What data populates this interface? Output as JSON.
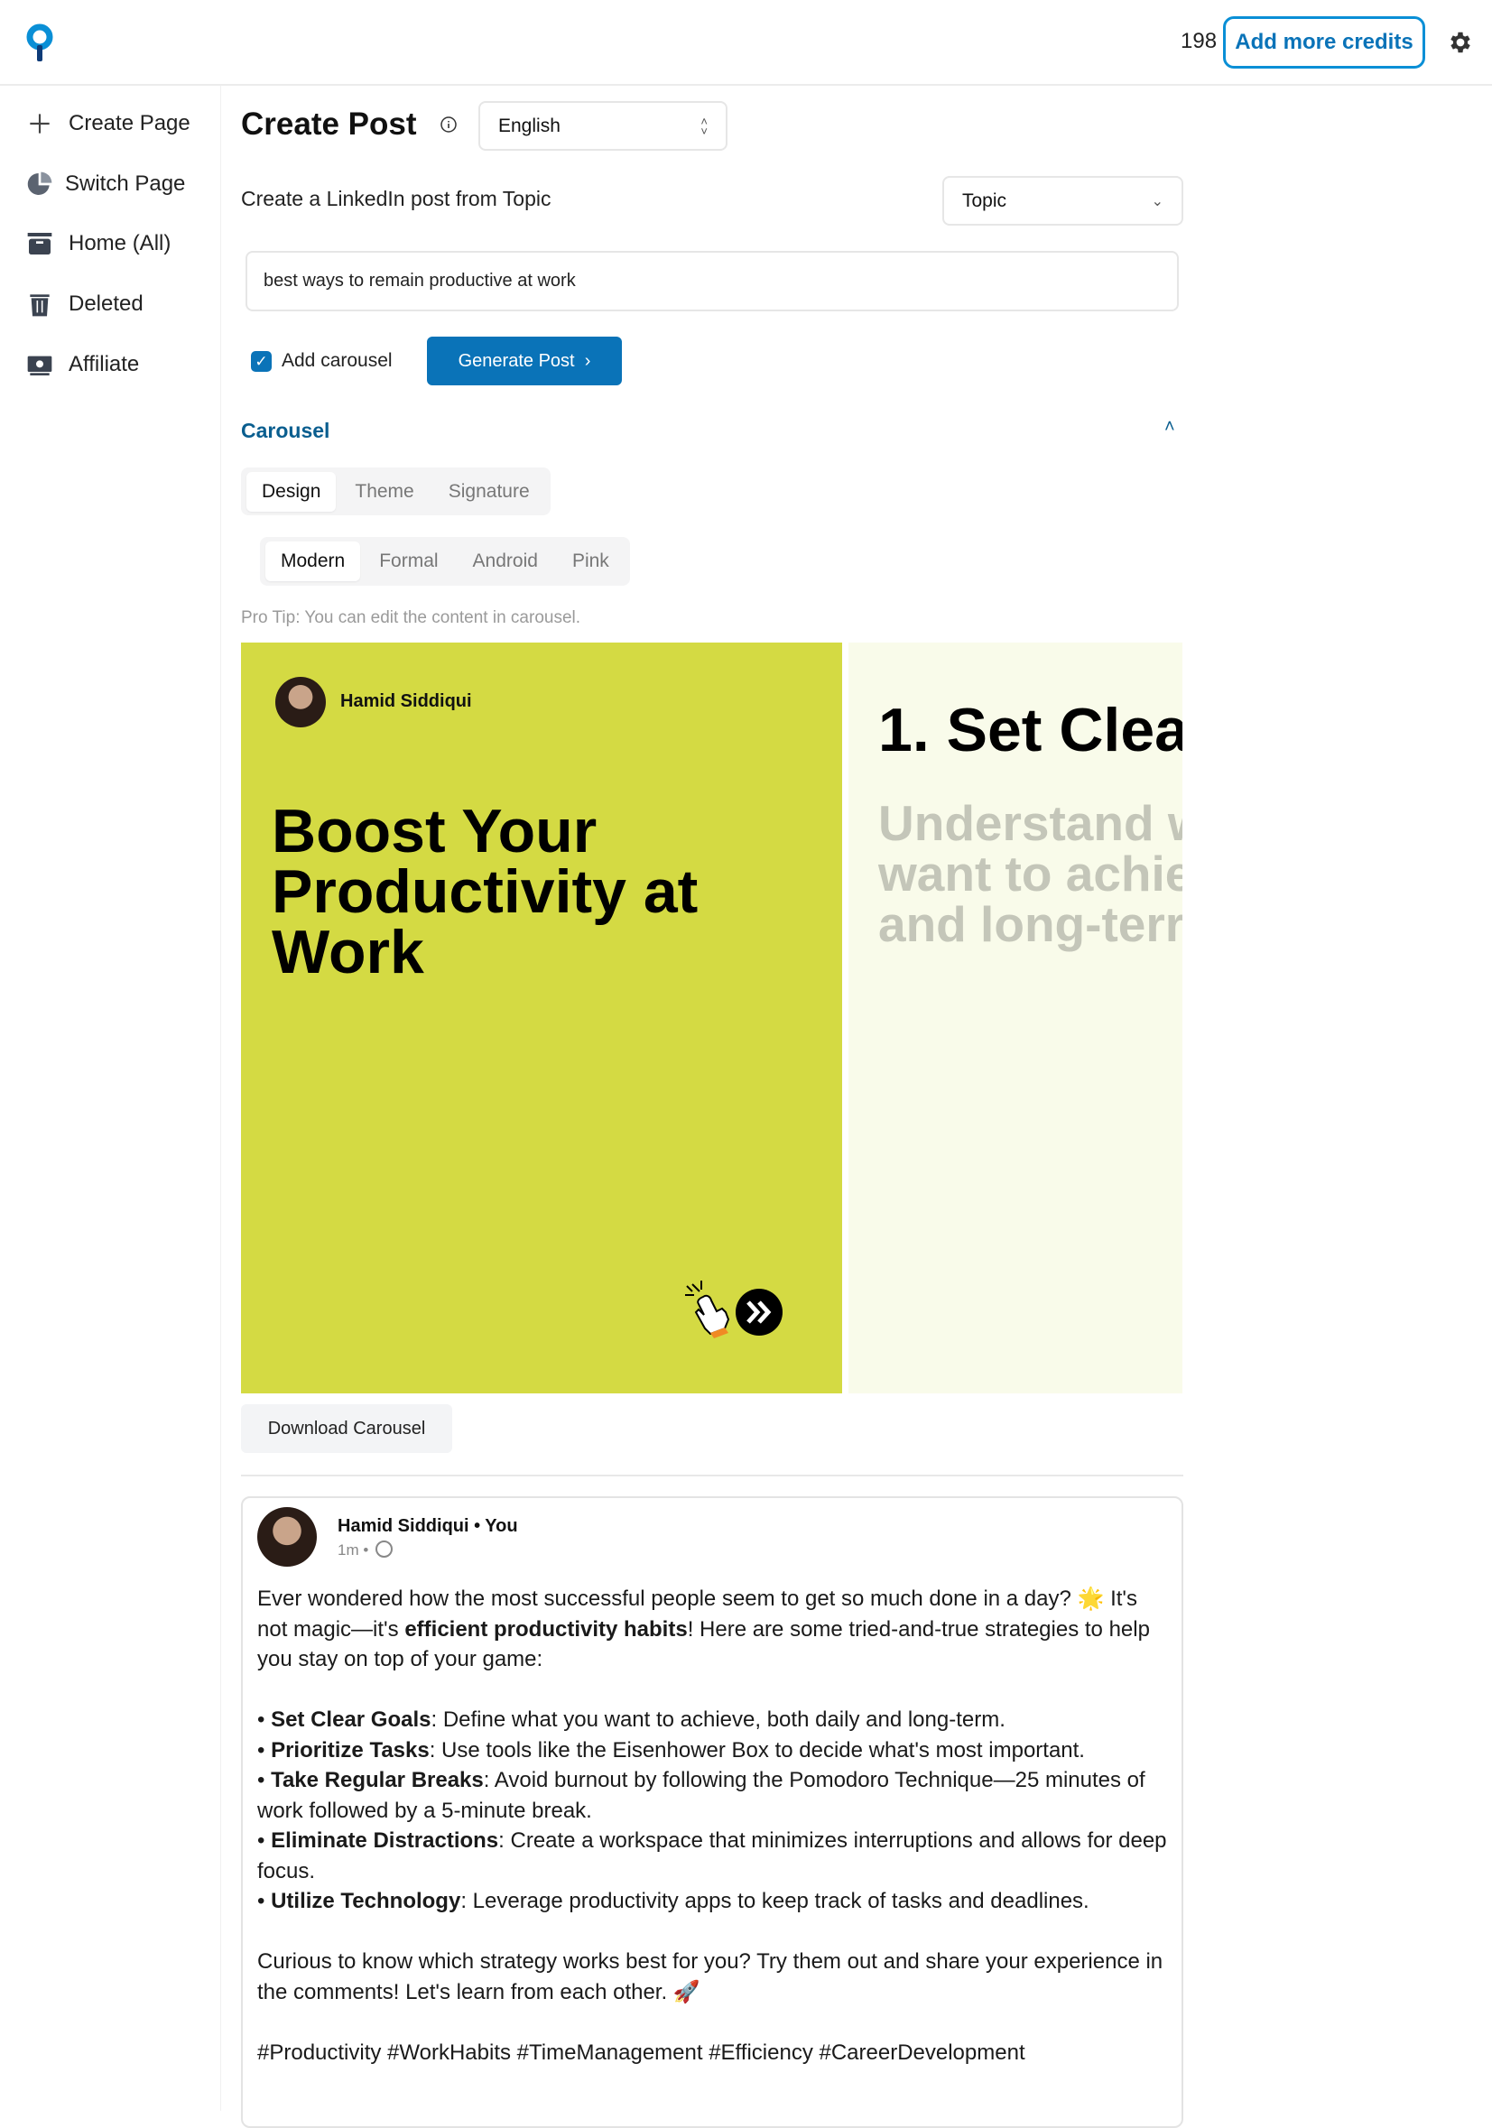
{
  "header": {
    "credits": "198",
    "add_credits_label": "Add more credits",
    "accent": "#0a73b8"
  },
  "sidebar": {
    "items": [
      {
        "label": "Create Page",
        "icon": "plus-icon"
      },
      {
        "label": "Switch Page",
        "icon": "pie-chart-icon"
      },
      {
        "label": "Home (All)",
        "icon": "archive-icon"
      },
      {
        "label": "Deleted",
        "icon": "trash-icon"
      },
      {
        "label": "Affiliate",
        "icon": "money-icon"
      }
    ]
  },
  "main": {
    "title": "Create Post",
    "language": "English",
    "source_label": "Create a LinkedIn post from Topic",
    "source_type": "Topic",
    "topic_value": "best ways to remain productive at work",
    "add_carousel_label": "Add carousel",
    "add_carousel_checked": true,
    "generate_label": "Generate Post",
    "carousel": {
      "heading": "Carousel",
      "tabs": [
        "Design",
        "Theme",
        "Signature"
      ],
      "active_tab": "Design",
      "styles": [
        "Modern",
        "Formal",
        "Android",
        "Pink"
      ],
      "active_style": "Modern",
      "pro_tip": "Pro Tip: You can edit the content in carousel.",
      "slide1": {
        "author": "Hamid Siddiqui",
        "title": "Boost Your Productivity at Work",
        "bg": "#d4da43"
      },
      "slide2": {
        "title": "1. Set Clea",
        "text": "Understand w want to achie and long-terr",
        "bg": "#f9fbea"
      },
      "download_label": "Download Carousel"
    },
    "post": {
      "author": "Hamid Siddiqui • You",
      "time": "1m •",
      "intro_a": "Ever wondered how the most successful people seem to get so much done in a day? 🌟  It's not magic—it's ",
      "intro_bold": "efficient productivity habits",
      "intro_b": "! Here are some tried-and-true strategies to help you stay on top of your game:",
      "bullets": [
        {
          "bold": "Set Clear Goals",
          "text": ": Define what you want to achieve, both daily and long-term."
        },
        {
          "bold": "Prioritize Tasks",
          "text": ": Use tools like the Eisenhower Box to decide what's most important."
        },
        {
          "bold": "Take Regular Breaks",
          "text": ": Avoid burnout by following the Pomodoro Technique—25 minutes of work followed by a 5-minute break."
        },
        {
          "bold": "Eliminate Distractions",
          "text": ": Create a workspace that minimizes interruptions and allows for deep focus."
        },
        {
          "bold": "Utilize Technology",
          "text": ": Leverage productivity apps to keep track of tasks and deadlines."
        }
      ],
      "closing": "Curious to know which strategy works best for you? Try them out and share your experience in the comments! Let's learn from each other. 🚀",
      "hashtags": "#Productivity #WorkHabits #TimeManagement #Efficiency #CareerDevelopment"
    }
  }
}
